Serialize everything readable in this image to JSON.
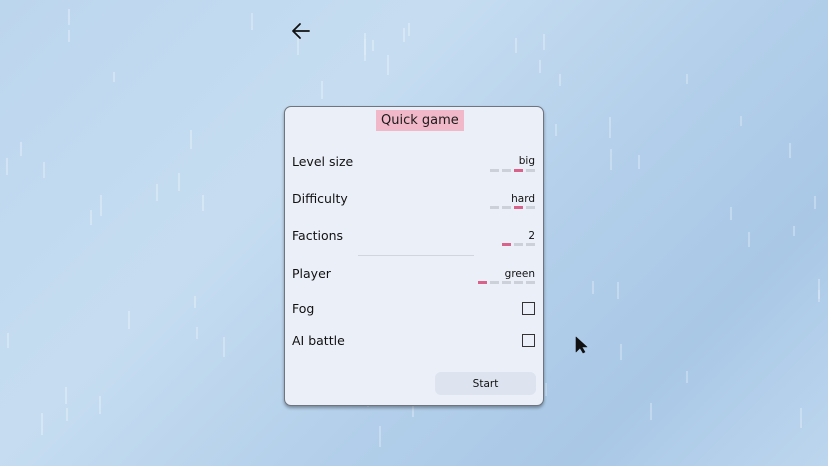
{
  "panel": {
    "title": "Quick game",
    "settings": [
      {
        "label": "Level size",
        "value": "big",
        "level": {
          "count": 4,
          "selected": 3
        }
      },
      {
        "label": "Difficulty",
        "value": "hard",
        "level": {
          "count": 4,
          "selected": 3
        }
      },
      {
        "label": "Factions",
        "value": "2",
        "level": {
          "count": 3,
          "selected": 1
        }
      },
      {
        "label": "Player",
        "value": "green",
        "level": {
          "count": 5,
          "selected": 1
        }
      }
    ],
    "toggles": [
      {
        "label": "Fog",
        "checked": false
      },
      {
        "label": "AI battle",
        "checked": false
      }
    ],
    "start_label": "Start"
  },
  "icons": {
    "back": "arrow-left-icon",
    "cursor": "mouse-pointer-icon"
  },
  "colors": {
    "accent": "#d9628a",
    "title_bg": "#f1b8c9",
    "panel_bg": "#ebeff8"
  }
}
